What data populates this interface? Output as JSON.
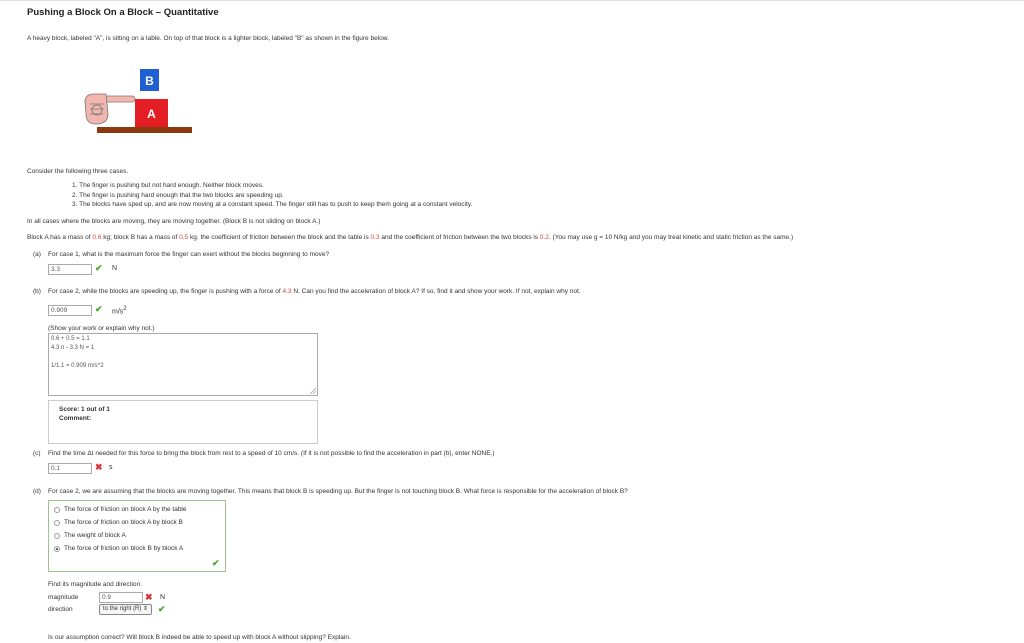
{
  "title": "Pushing a Block On a Block – Quantitative",
  "intro": "A heavy block, labeled \"A\", is sitting on a table. On top of that block is a lighter block, labeled \"B\" as shown in the figure below.",
  "figure": {
    "block_a_label": "A",
    "block_b_label": "B",
    "colors": {
      "block_a": "#e31e24",
      "block_b": "#1f5fd1",
      "table": "#8b3a10",
      "hand": "#f2b6ae"
    }
  },
  "cases_intro": "Consider the following three cases.",
  "cases": [
    "1. The finger is pushing but not hard enough. Neither block moves.",
    "2. The finger is pushing hard enough that the two blocks are speeding up.",
    "3. The blocks have sped up, and are now moving at a constant speed. The finger still has to push to keep them going at a constant velocity."
  ],
  "together_note": "In all cases where the blocks are moving, they are moving together. (Block B is not sliding on block A.)",
  "given": {
    "p1": "Block A has a mass of ",
    "mass_a": "0.6",
    "p2": " kg; block B has a mass of ",
    "mass_b": "0.5",
    "p3": " kg. the coefficient of friction between the block and the table is ",
    "mu_table": "0.3",
    "p4": " and the coefficient of friction between the two blocks is ",
    "mu_blocks": "0.2",
    "p5": ". (You may use g = 10 N/kg and you may treat kinetic and static friction as the same.)"
  },
  "part_a": {
    "label": "(a)",
    "question": "For case 1, what is the maximum force the finger can exert without the blocks beginning to move?",
    "answer": "3.3",
    "unit": "N"
  },
  "part_b": {
    "label": "(b)",
    "q1": "For case 2, while the blocks are speeding up, the finger is pushing with a force of ",
    "force": "4.3",
    "q2": " N. Can you find the acceleration of block A? If so, find it and show your work. If not, explain why not.",
    "answer": "0.909",
    "unit": "m/s",
    "unit_sup": "2",
    "work_label": "(Show your work or explain why not.)",
    "work_lines": [
      "0.6 + 0.5 = 1.1",
      "4.3 n - 3.3 N = 1",
      "",
      "1/1.1 = 0.909 m/s^2"
    ],
    "score": "Score: 1 out of 1",
    "comment": "Comment:"
  },
  "part_c": {
    "label": "(c)",
    "question": "Find the time Δt needed for this force to bring the block from rest to a speed of 10 cm/s. (If it is not possible to find the acceleration in part (b), enter NONE.)",
    "answer": "0.1",
    "unit": "s"
  },
  "part_d": {
    "label": "(d)",
    "question": "For case 2, we are assuming that the blocks are moving together. This means that block B is speeding up. But the finger is not touching block B. What force is responsible for the acceleration of block B?",
    "options": [
      "The force of friction on block A by the table",
      "The force of friction on block A by block B",
      "The weight of block A",
      "The force of friction on block B by block A"
    ],
    "selected_index": 3,
    "find_label": "Find its magnitude and direction.",
    "magnitude_label": "magnitude",
    "magnitude_value": "0.9",
    "magnitude_unit": "N",
    "direction_label": "direction",
    "direction_value": "to the right (R)"
  },
  "final_question": "Is our assumption correct? Will block B indeed be able to speed up with block A without slipping? Explain."
}
